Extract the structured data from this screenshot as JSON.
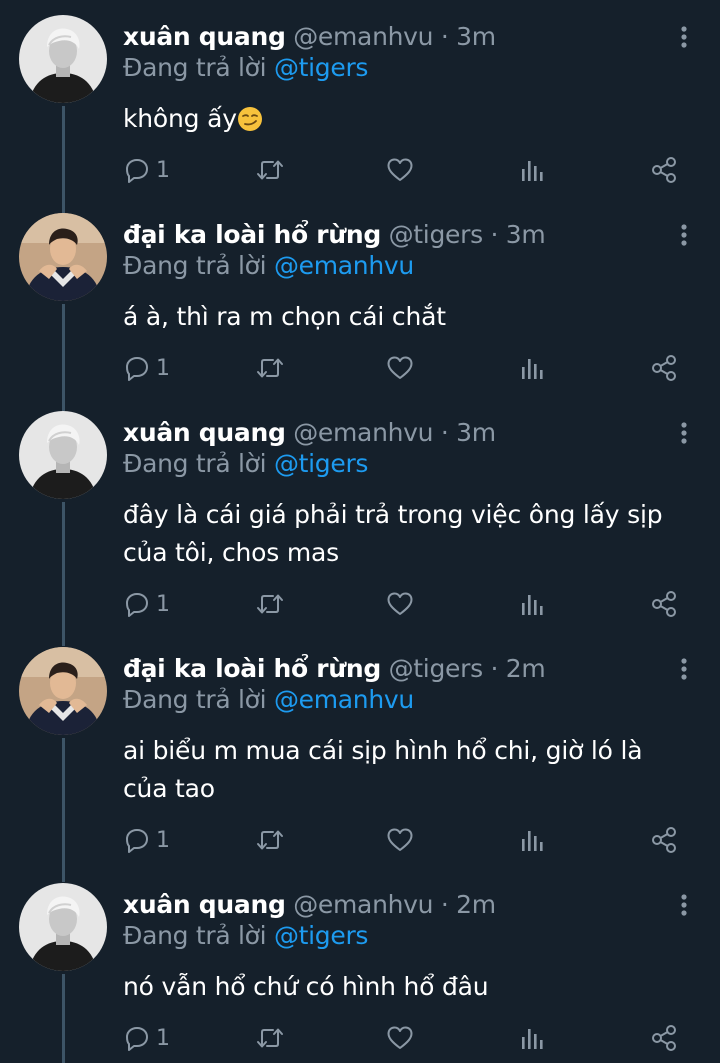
{
  "colors": {
    "background": "#15202b",
    "text_primary": "#ffffff",
    "text_secondary": "#8b98a5",
    "accent": "#1d9bf0",
    "thread_line": "#3d5466"
  },
  "icons": {
    "reply": "reply-icon",
    "retweet": "retweet-icon",
    "like": "heart-icon",
    "analytics": "analytics-icon",
    "share": "share-icon",
    "more": "more-vertical-icon"
  },
  "tweets": [
    {
      "display_name": "xuân quang",
      "handle": "@emanhvu",
      "separator": "·",
      "time": "3m",
      "reply_prefix": "Đang trả lời",
      "reply_to": "@tigers",
      "text": "không ấy",
      "emoji": "smirking-face-emoji",
      "reply_count": "1"
    },
    {
      "display_name": "đại ka loài hổ rừng",
      "handle": "@tigers",
      "separator": "·",
      "time": "3m",
      "reply_prefix": "Đang trả lời",
      "reply_to": "@emanhvu",
      "text": "á à, thì ra m chọn cái chắt",
      "reply_count": "1"
    },
    {
      "display_name": "xuân quang",
      "handle": "@emanhvu",
      "separator": "·",
      "time": "3m",
      "reply_prefix": "Đang trả lời",
      "reply_to": "@tigers",
      "text": "đây là cái giá phải trả trong việc ông lấy sịp của tôi, chos mas",
      "reply_count": "1"
    },
    {
      "display_name": "đại ka loài hổ rừng",
      "handle": "@tigers",
      "separator": "·",
      "time": "2m",
      "reply_prefix": "Đang trả lời",
      "reply_to": "@emanhvu",
      "text": "ai biểu m mua cái sịp hình hổ chi, giờ ló là của tao",
      "reply_count": "1"
    },
    {
      "display_name": "xuân quang",
      "handle": "@emanhvu",
      "separator": "·",
      "time": "2m",
      "reply_prefix": "Đang trả lời",
      "reply_to": "@tigers",
      "text": "nó vẫn hổ chứ có hình hổ đâu",
      "reply_count": "1"
    }
  ]
}
